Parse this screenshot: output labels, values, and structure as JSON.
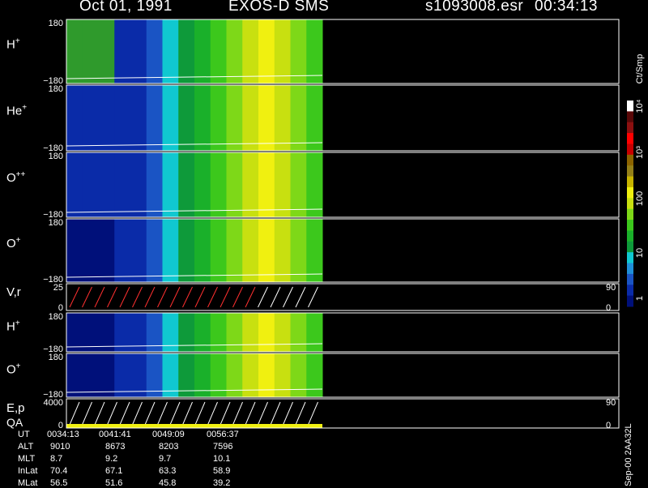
{
  "header": {
    "date": "Oct 01, 1991",
    "mission": "EXOS-D SMS",
    "file": "s1093008.esr",
    "time": "00:34:13"
  },
  "colorbar": {
    "unit": "Ct/Smp",
    "tick_labels": [
      "1",
      "10",
      "100",
      "10³",
      "10⁴"
    ],
    "colors": [
      "#00107a",
      "#0a2ba8",
      "#1a54c4",
      "#1f8fd8",
      "#10c8d0",
      "#0e9a3a",
      "#1ab02a",
      "#3cc81c",
      "#7ed818",
      "#c8e010",
      "#f0f010",
      "#c8b400",
      "#948018",
      "#8c6400",
      "#c80000",
      "#ff0000",
      "#8c1010",
      "#5a0808",
      "#ffffff"
    ]
  },
  "chart_data": {
    "type": "heatmap",
    "panels": [
      {
        "label": "H",
        "sup": "+",
        "ymax": "180",
        "ymin": "−180",
        "start_color": "#2f9a2c",
        "kind": "spec"
      },
      {
        "label": "He",
        "sup": "+",
        "ymax": "180",
        "ymin": "−180",
        "start_color": "#0a2ba8",
        "kind": "spec"
      },
      {
        "label": "O",
        "sup": "++",
        "ymax": "180",
        "ymin": "−180",
        "start_color": "#0a2ba8",
        "kind": "spec"
      },
      {
        "label": "O",
        "sup": "+",
        "ymax": "180",
        "ymin": "−180",
        "start_color": "#00107a",
        "kind": "spec"
      },
      {
        "label": "V,r",
        "sup": "",
        "ymax": "25",
        "ymin": "0",
        "right_top": "90",
        "right_bottom": "0",
        "kind": "line"
      },
      {
        "label": "H",
        "sup": "+",
        "ymax": "180",
        "ymin": "−180",
        "start_color": "#00107a",
        "kind": "spec"
      },
      {
        "label": "O",
        "sup": "+",
        "ymax": "180",
        "ymin": "−180",
        "start_color": "#00107a",
        "kind": "spec"
      },
      {
        "label": "E,p",
        "label2": "QA",
        "sup": "",
        "ymax": "4000",
        "ymin": "0",
        "right_top": "90",
        "right_bottom": "0",
        "kind": "line"
      }
    ]
  },
  "footer": {
    "rows": [
      {
        "label": "UT",
        "values": [
          "0034:13",
          "0041:41",
          "0049:09",
          "0056:37"
        ]
      },
      {
        "label": "ALT",
        "values": [
          "9010",
          "8673",
          "8203",
          "7596"
        ]
      },
      {
        "label": "MLT",
        "values": [
          "8.7",
          "9.2",
          "9.7",
          "10.1"
        ]
      },
      {
        "label": "InLat",
        "values": [
          "70.4",
          "67.1",
          "63.3",
          "58.9"
        ]
      },
      {
        "label": "MLat",
        "values": [
          "56.5",
          "51.6",
          "45.8",
          "39.2"
        ]
      }
    ],
    "side_label": "Sep-00  2AA32L"
  }
}
